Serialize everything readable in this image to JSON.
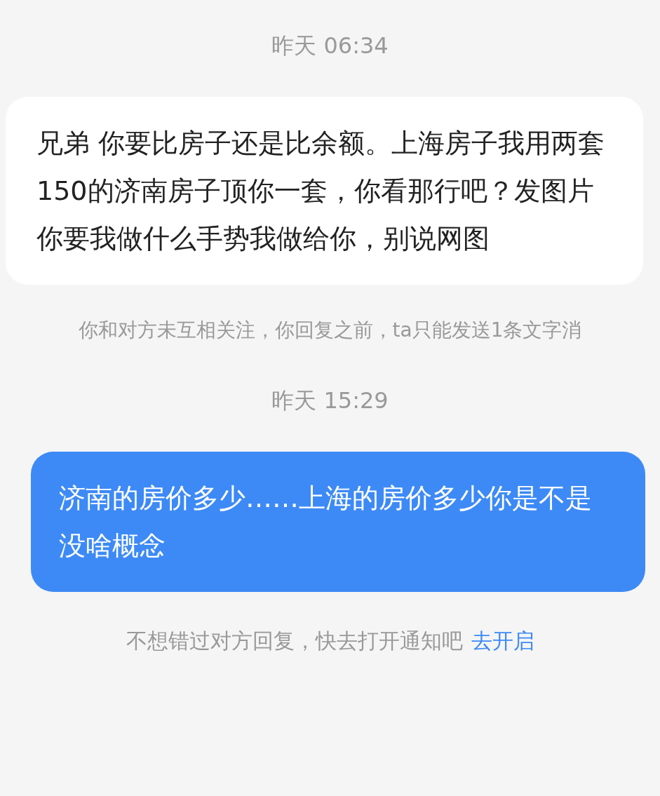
{
  "messages": [
    {
      "kind": "time",
      "text": "昨天 06:34"
    },
    {
      "kind": "incoming",
      "text": "兄弟 你要比房子还是比余额。上海房子我用两套150的济南房子顶你一套，你看那行吧？发图片你要我做什么手势我做给你，别说网图"
    },
    {
      "kind": "notice",
      "text": "你和对方未互相关注，你回复之前，ta只能发送1条文字消"
    },
    {
      "kind": "time",
      "text": "昨天 15:29"
    },
    {
      "kind": "outgoing",
      "text": "济南的房价多少……上海的房价多少你是不是没啥概念"
    }
  ],
  "footer": {
    "text": "不想错过对方回复，快去打开通知吧",
    "link": "去开启"
  }
}
